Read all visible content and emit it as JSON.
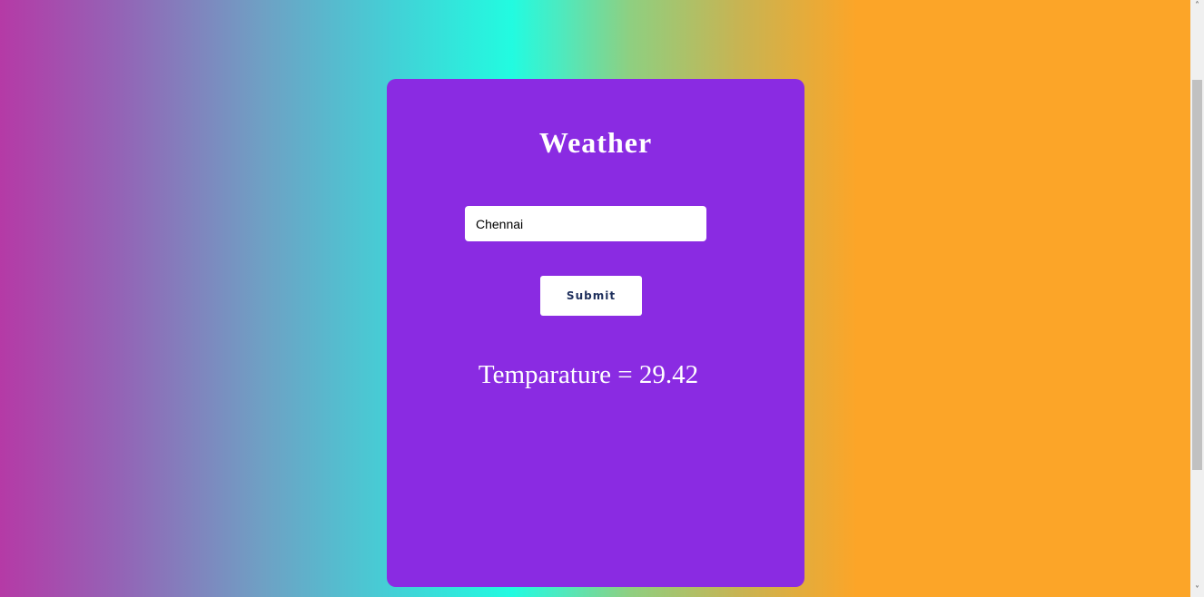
{
  "card": {
    "title": "Weather",
    "city_input": {
      "value": "Chennai",
      "placeholder": ""
    },
    "submit_label": "Submit",
    "temperature": {
      "label": "Temparature",
      "separator": " = ",
      "value": "29.42",
      "display": "Temparature = 29.42"
    }
  },
  "scrollbar": {
    "up_icon": "chevron-up-icon",
    "down_icon": "chevron-down-icon"
  },
  "colors": {
    "card_background": "#8a2be2",
    "gradient_left": "#b53aa6",
    "gradient_mid": "#22fbe0",
    "gradient_right": "#fca528",
    "button_text": "#1e2f5c"
  }
}
